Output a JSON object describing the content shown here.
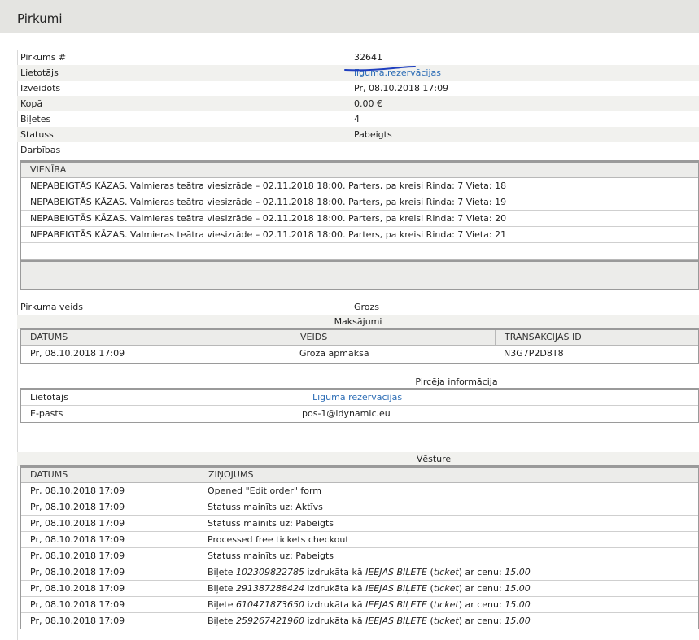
{
  "page": {
    "title": "Pirkumi"
  },
  "order": {
    "fields": [
      {
        "key": "Pirkums #",
        "value": "32641"
      },
      {
        "key": "Lietotājs",
        "value": "līguma.rezervācijas"
      },
      {
        "key": "Izveidots",
        "value": "Pr, 08.10.2018 17:09"
      },
      {
        "key": "Kopā",
        "value": "0.00 €"
      },
      {
        "key": "Biļetes",
        "value": "4"
      },
      {
        "key": "Statuss",
        "value": "Pabeigts"
      },
      {
        "key": "Darbības",
        "value": ""
      }
    ]
  },
  "items": {
    "header": "VIENĪBA",
    "rows": [
      "NEPABEIGTĀS KĀZAS. Valmieras teātra viesizrāde – 02.11.2018 18:00. Parters, pa kreisi Rinda: 7 Vieta: 18",
      "NEPABEIGTĀS KĀZAS. Valmieras teātra viesizrāde – 02.11.2018 18:00. Parters, pa kreisi Rinda: 7 Vieta: 19",
      "NEPABEIGTĀS KĀZAS. Valmieras teātra viesizrāde – 02.11.2018 18:00. Parters, pa kreisi Rinda: 7 Vieta: 20",
      "NEPABEIGTĀS KĀZAS. Valmieras teātra viesizrāde – 02.11.2018 18:00. Parters, pa kreisi Rinda: 7 Vieta: 21"
    ]
  },
  "purchase_type": {
    "key": "Pirkuma veids",
    "value": "Grozs"
  },
  "payments": {
    "title": "Maksājumi",
    "headers": [
      "DATUMS",
      "VEIDS",
      "TRANSAKCIJAS ID"
    ],
    "rows": [
      [
        "Pr, 08.10.2018 17:09",
        "Groza apmaksa",
        "N3G7P2D8T8"
      ]
    ]
  },
  "buyer": {
    "title": "Pircēja informācija",
    "rows": [
      {
        "key": "Lietotājs",
        "value": "Līguma rezervācijas"
      },
      {
        "key": "E-pasts",
        "value": "pos-1@idynamic.eu"
      }
    ]
  },
  "history": {
    "title": "Vēsture",
    "headers": [
      "DATUMS",
      "ZIŅOJUMS"
    ],
    "rows": [
      {
        "date": "Pr, 08.10.2018 17:09",
        "message": "Opened \"Edit order\" form"
      },
      {
        "date": "Pr, 08.10.2018 17:09",
        "message": "Statuss mainīts uz: Aktīvs"
      },
      {
        "date": "Pr, 08.10.2018 17:09",
        "message": "Statuss mainīts uz: Pabeigts"
      },
      {
        "date": "Pr, 08.10.2018 17:09",
        "message": "Processed free tickets checkout"
      },
      {
        "date": "Pr, 08.10.2018 17:09",
        "message": "Statuss mainīts uz: Pabeigts"
      }
    ],
    "ticket_rows": [
      {
        "date": "Pr, 08.10.2018 17:09",
        "prefix": "Biļete ",
        "number": "102309822785",
        "mid": " izdrukāta kā ",
        "category": "IEEJAS BIĻETE",
        "sub_open": " (",
        "sub": "ticket",
        "sub_close": ") ar cenu: ",
        "price": "15.00"
      },
      {
        "date": "Pr, 08.10.2018 17:09",
        "prefix": "Biļete ",
        "number": "291387288424",
        "mid": " izdrukāta kā ",
        "category": "IEEJAS BIĻETE",
        "sub_open": " (",
        "sub": "ticket",
        "sub_close": ") ar cenu: ",
        "price": "15.00"
      },
      {
        "date": "Pr, 08.10.2018 17:09",
        "prefix": "Biļete ",
        "number": "610471873650",
        "mid": " izdrukāta kā ",
        "category": "IEEJAS BIĻETE",
        "sub_open": " (",
        "sub": "ticket",
        "sub_close": ") ar cenu: ",
        "price": "15.00"
      },
      {
        "date": "Pr, 08.10.2018 17:09",
        "prefix": "Biļete ",
        "number": "259267421960",
        "mid": " izdrukāta kā ",
        "category": "IEEJAS BIĻETE",
        "sub_open": " (",
        "sub": "ticket",
        "sub_close": ") ar cenu: ",
        "price": "15.00"
      }
    ]
  },
  "colors": {
    "link": "#2b6cb5",
    "header_bg": "#e4e4e1",
    "row_shade": "#f1f1ee",
    "grid_head": "#ececea",
    "annotation": "#1f3fbf"
  }
}
